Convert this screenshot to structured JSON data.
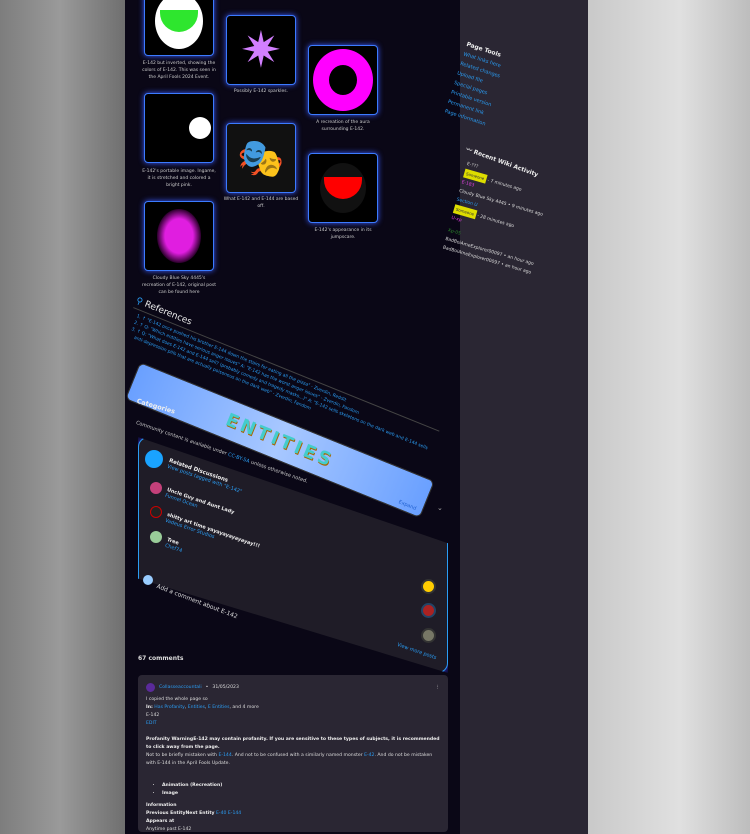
{
  "gallery": [
    {
      "caption": "E-142 but inverted, showing the colors of E-142. This was seen in the April Fools 2024 Event."
    },
    {
      "caption": "Possibly E-142 sparkles."
    },
    {
      "caption": "A recreation of the aura surrounding E-142."
    },
    {
      "caption": "E-142's portable image. Ingame, it is stretched and colored a bright pink."
    },
    {
      "caption": "What E-142 and E-144 are based off."
    },
    {
      "caption": "E-142's appearance in its jumpscare."
    },
    {
      "caption": "Cloudy Blue Sky 4445's recreation of E-142, original post can be found here"
    }
  ],
  "references": {
    "title": "References",
    "items": [
      "↑ \"E-142 once pushed his brother E-144 down the stairs for eating all the pizza\" - Zverdin, Reddit",
      "↑ Q: \"Which entities have serious anger issues\" A: \"E-142 has the worst anger issues\" - Zverdin, Fandom",
      "↑ Q: \"What does E-142 and E-144 sell? (probably comedy and tragedy masks...)\" A: \"E-142 sells skeletons on the dark web and E-144 sells anti-depression pills that are actually poisonous on the dark web\" - Zverdin, Fandom"
    ]
  },
  "banner": {
    "text": "ENTITIES",
    "expand": "Expand"
  },
  "categories": {
    "title": "Categories"
  },
  "license": {
    "prefix": "Community content is available under",
    "link": "CC-BY-SA",
    "suffix": "unless otherwise noted."
  },
  "discussions": {
    "title": "Related Discussions",
    "subtitle": "View posts tagged with \"E-142\"",
    "posts": [
      {
        "title": "Uncle Guy and Aunt Lady",
        "author": "Funnel Ocean"
      },
      {
        "title": "shitty art time yayayayayayayay!!!",
        "author": "Vadeus Error Studios"
      },
      {
        "title": "Tree",
        "author": "Chef74"
      }
    ],
    "view_more": "View more posts"
  },
  "add_comment": "Add a comment about E-142",
  "comments_count": "67 comments",
  "comment": {
    "user": "Collasseaccountali",
    "date": "31/05/2023",
    "l1": "I copied the whole page so",
    "in": "In:",
    "tags": [
      "Has Profanity",
      "Entities",
      "E Entities"
    ],
    "more": ", and 4 more",
    "name": "E-142",
    "edit": "EDIT",
    "warn": "Profanity WarningE-142 may contain profanity. If you are sensitive to these types of subjects, it is recommended to click away from the page.",
    "not1": "Not to be briefly mistaken with",
    "l144": "E-144",
    "not2": ". And not to be confused with a similarly named monster",
    "l42": "E-42",
    "not3": ". And do not be mistaken with E-144 in the April Fools Update.",
    "bul": [
      "Animation (Recreation)",
      "Image"
    ],
    "info": "Information",
    "prev": "Previous EntityNext Entity",
    "prevl": "E-40 E-144",
    "appears": "Appears at",
    "any": "Anytime past E-142"
  },
  "sidebar": {
    "tools_title": "Page Tools",
    "tools": [
      "What links here",
      "Related changes",
      "Upload file",
      "Special pages",
      "Printable version",
      "Permanent link",
      "Page information"
    ],
    "activity_title": "Recent Wiki Activity",
    "activity": [
      {
        "page": "E-???",
        "tag": "Someone",
        "meta": "- 7 minutes ago",
        "color": "#ccc"
      },
      {
        "page": "E-183",
        "tag": "",
        "meta": "Cloudy Blue Sky 4445 • 9 minutes ago",
        "color": "#e040e0"
      },
      {
        "page": "Section U",
        "tag": "Someone",
        "meta": "- 28 minutes ago",
        "color": "#2a9df4"
      },
      {
        "page": "U-xp",
        "tag": "",
        "meta": "",
        "color": "#e040e0"
      },
      {
        "page": "Xp-05",
        "tag": "",
        "meta": "BadBoiAmeExplorer00097 • an hour ago",
        "color": "#2c8a2c"
      },
      {
        "page": "",
        "tag": "",
        "meta": "BadBoiAmeExplorer00097 • an hour ago",
        "color": "#ccc"
      }
    ]
  }
}
